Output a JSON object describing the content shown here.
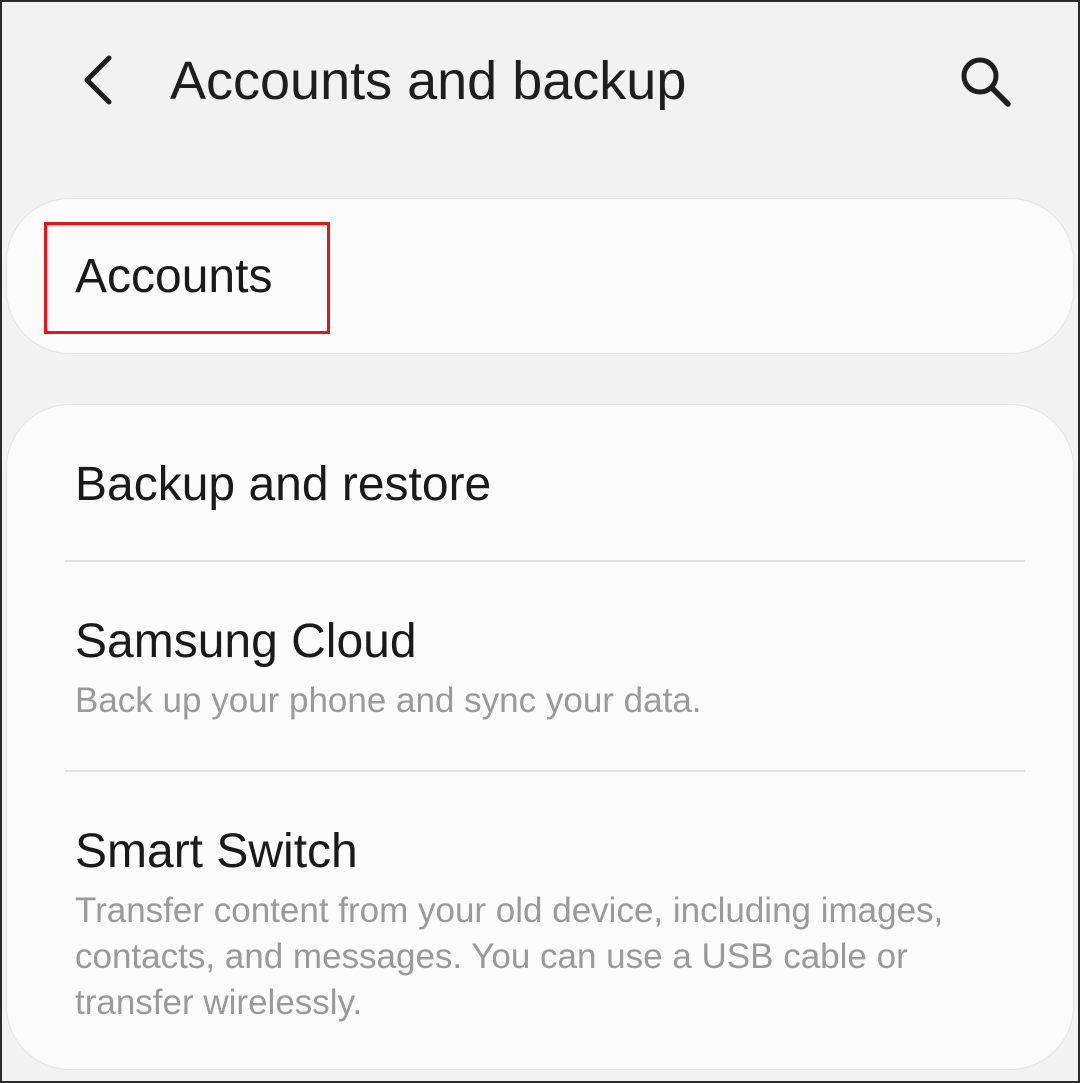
{
  "header": {
    "back_icon": "chevron-left-icon",
    "title": "Accounts and backup",
    "search_icon": "search-icon"
  },
  "accounts": {
    "label": "Accounts",
    "highlight_color": "#e8141c"
  },
  "list": {
    "items": [
      {
        "title": "Backup and restore",
        "subtitle": ""
      },
      {
        "title": "Samsung Cloud",
        "subtitle": "Back up your phone and sync your data."
      },
      {
        "title": "Smart Switch",
        "subtitle": "Transfer content from your old device, including images, contacts, and messages. You can use a USB cable or transfer wirelessly."
      }
    ]
  }
}
